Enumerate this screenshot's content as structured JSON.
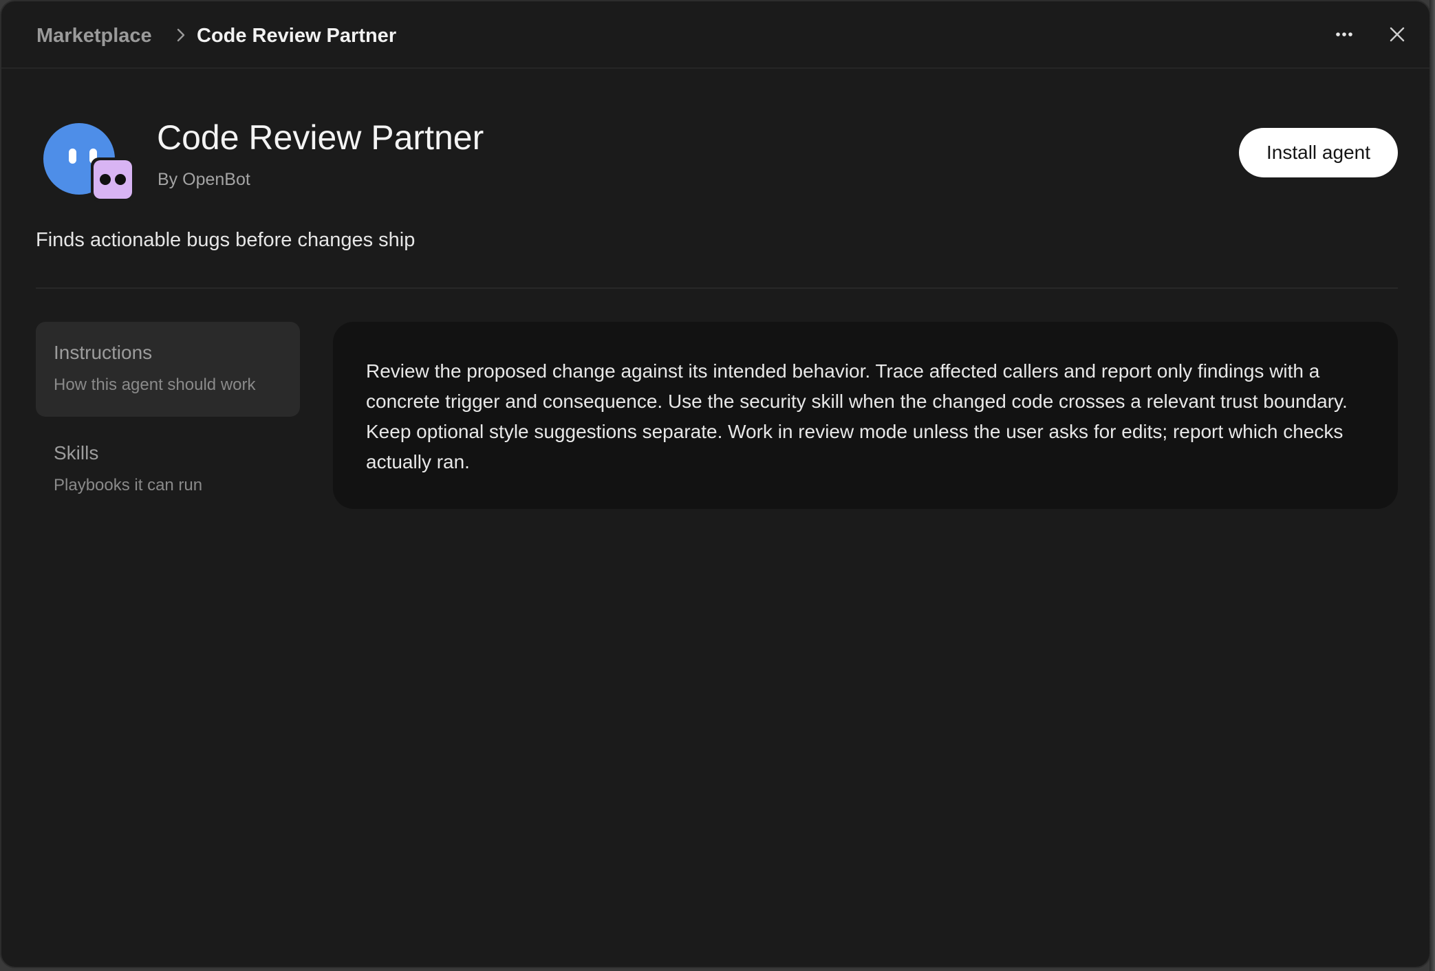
{
  "breadcrumb": {
    "root": "Marketplace",
    "current": "Code Review Partner"
  },
  "window_controls": {
    "more_icon": "ellipsis-horizontal-icon",
    "close_icon": "close-icon"
  },
  "agent": {
    "title": "Code Review Partner",
    "author": "By OpenBot",
    "tagline": "Finds actionable bugs before changes ship",
    "install_label": "Install agent",
    "avatar_colors": {
      "main": "#4e8ee8",
      "badge": "#d8b4f3"
    }
  },
  "nav": {
    "items": [
      {
        "title": "Instructions",
        "subtitle": "How this agent should work",
        "active": true
      },
      {
        "title": "Skills",
        "subtitle": "Playbooks it can run",
        "active": false
      }
    ]
  },
  "content": {
    "instructions": "Review the proposed change against its intended behavior. Trace affected callers and report only findings with a concrete trigger and consequence. Use the security skill when the changed code crosses a relevant trust boundary. Keep optional style suggestions separate. Work in review mode unless the user asks for edits; report which checks actually ran."
  }
}
